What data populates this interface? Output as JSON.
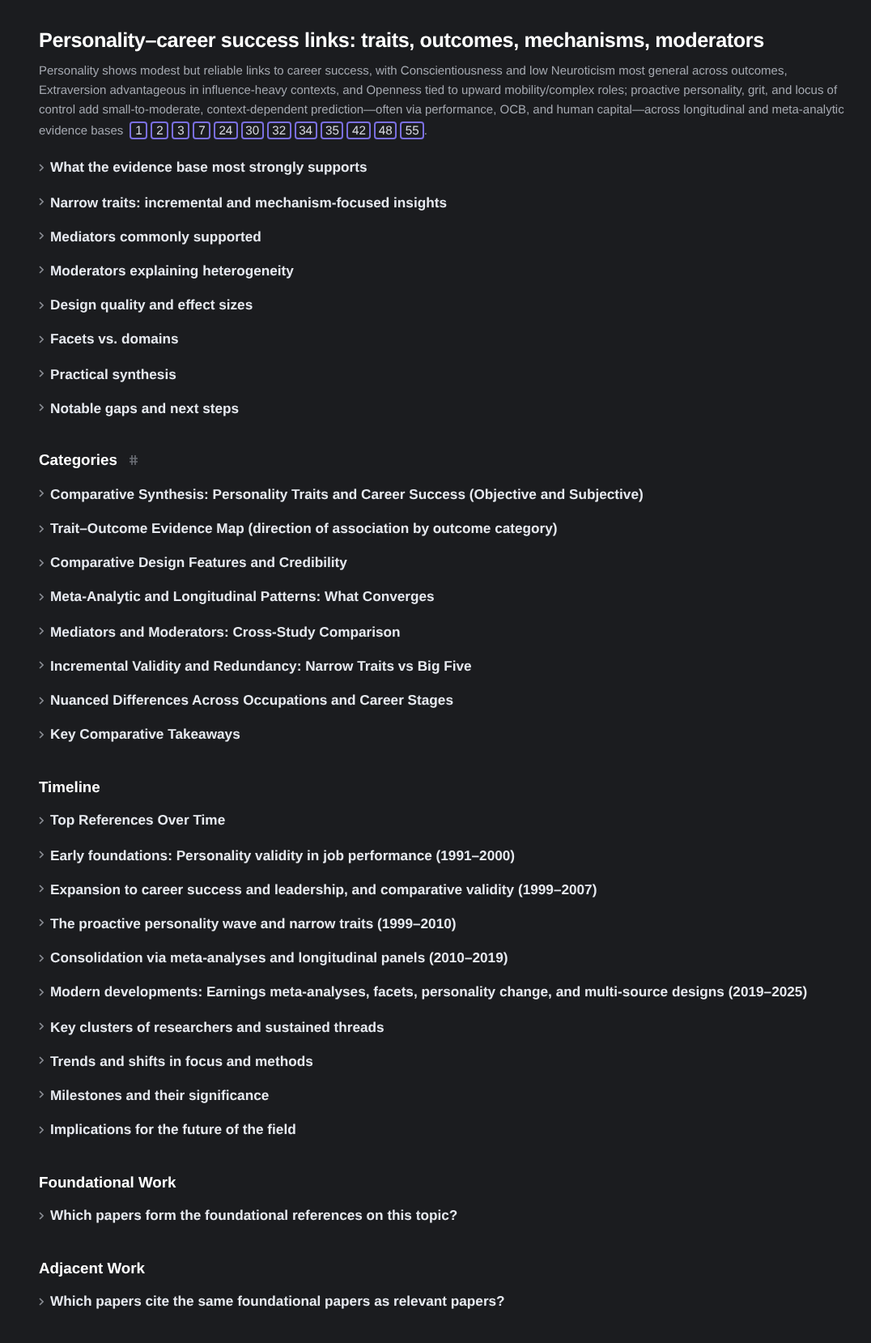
{
  "title": "Personality–career success links: traits, outcomes, mechanisms, moderators",
  "summary": {
    "text": "Personality shows modest but reliable links to career success, with Conscientiousness and low Neuroticism most general across outcomes, Extraversion advantageous in influence-heavy contexts, and Openness tied to upward mobility/complex roles; proactive personality, grit, and locus of control add small-to-moderate, context-dependent prediction—often via performance, OCB, and human capital—across longitudinal and meta-analytic evidence bases",
    "citations": [
      "1",
      "2",
      "3",
      "7",
      "24",
      "30",
      "32",
      "34",
      "35",
      "42",
      "48",
      "55"
    ],
    "end": "."
  },
  "sections": [
    {
      "items": [
        "What the evidence base most strongly supports",
        "Narrow traits: incremental and mechanism-focused insights",
        "Mediators commonly supported",
        "Moderators explaining heterogeneity",
        "Design quality and effect sizes",
        "Facets vs. domains",
        "Practical synthesis",
        "Notable gaps and next steps"
      ]
    },
    {
      "heading": "Categories",
      "anchor": true,
      "items": [
        "Comparative Synthesis: Personality Traits and Career Success (Objective and Subjective)",
        "Trait–Outcome Evidence Map (direction of association by outcome category)",
        "Comparative Design Features and Credibility",
        "Meta-Analytic and Longitudinal Patterns: What Converges",
        "Mediators and Moderators: Cross-Study Comparison",
        "Incremental Validity and Redundancy: Narrow Traits vs Big Five",
        "Nuanced Differences Across Occupations and Career Stages",
        "Key Comparative Takeaways"
      ]
    },
    {
      "heading": "Timeline",
      "items": [
        "Top References Over Time",
        "Early foundations: Personality validity in job performance (1991–2000)",
        "Expansion to career success and leadership, and comparative validity (1999–2007)",
        "The proactive personality wave and narrow traits (1999–2010)",
        "Consolidation via meta-analyses and longitudinal panels (2010–2019)",
        "Modern developments: Earnings meta-analyses, facets, personality change, and multi-source designs (2019–2025)",
        "Key clusters of researchers and sustained threads",
        "Trends and shifts in focus and methods",
        "Milestones and their significance",
        "Implications for the future of the field"
      ]
    },
    {
      "heading": "Foundational Work",
      "items": [
        "Which papers form the foundational references on this topic?"
      ]
    },
    {
      "heading": "Adjacent Work",
      "items": [
        "Which papers cite the same foundational papers as relevant papers?"
      ]
    }
  ]
}
